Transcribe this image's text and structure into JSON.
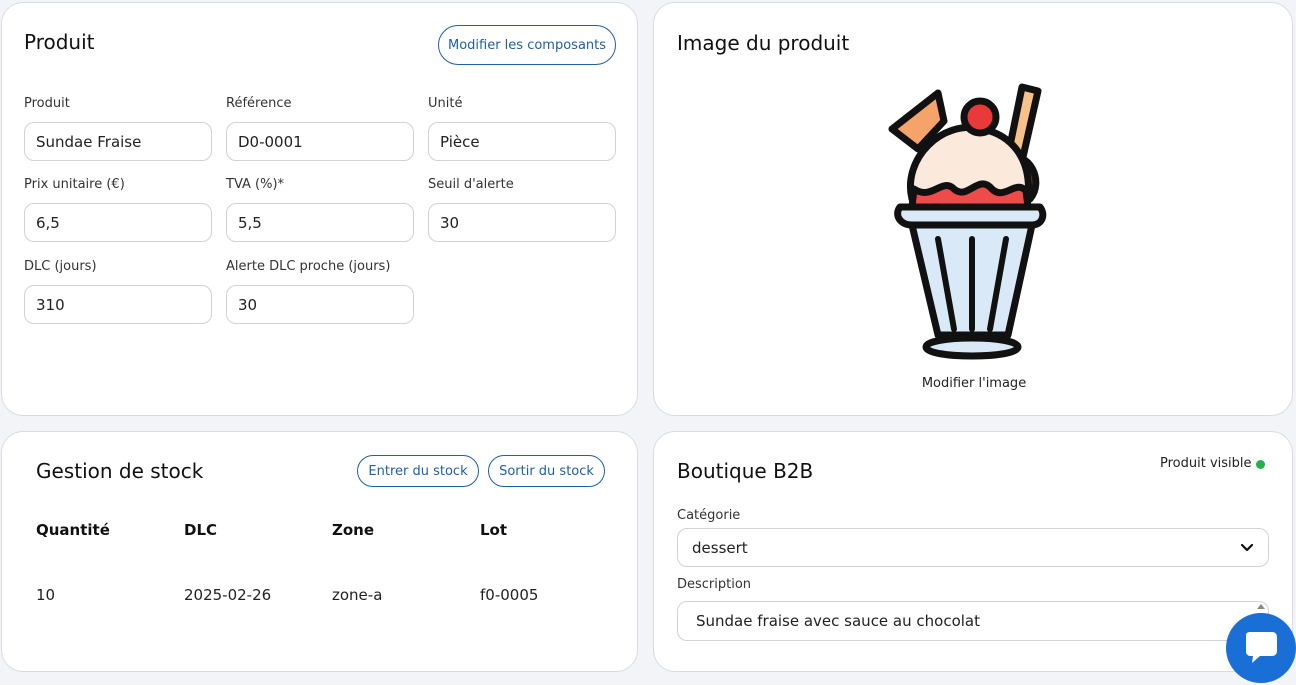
{
  "produit_card": {
    "title": "Produit",
    "modify_components_label": "Modifier les composants",
    "fields": {
      "produit": {
        "label": "Produit",
        "value": "Sundae Fraise"
      },
      "reference": {
        "label": "Référence",
        "value": "D0-0001"
      },
      "unite": {
        "label": "Unité",
        "value": "Pièce"
      },
      "prix_unitaire": {
        "label": "Prix unitaire (€)",
        "value": "6,5"
      },
      "tva": {
        "label": "TVA (%)*",
        "value": "5,5"
      },
      "seuil_alerte": {
        "label": "Seuil d'alerte",
        "value": "30"
      },
      "dlc_jours": {
        "label": "DLC (jours)",
        "value": "310"
      },
      "alerte_dlc": {
        "label": "Alerte DLC proche (jours)",
        "value": "30"
      }
    }
  },
  "image_card": {
    "title": "Image du produit",
    "image_icon": "sundae-icon",
    "modify_image_label": "Modifier l'image"
  },
  "stock_card": {
    "title": "Gestion de stock",
    "enter_stock_label": "Entrer du stock",
    "exit_stock_label": "Sortir du stock",
    "columns": [
      "Quantité",
      "DLC",
      "Zone",
      "Lot"
    ],
    "rows": [
      [
        "10",
        "2025-02-26",
        "zone-a",
        "f0-0005"
      ]
    ]
  },
  "boutique_card": {
    "title": "Boutique B2B",
    "visibility_label": "Produit visible",
    "visibility_color": "#22b14c",
    "category_label": "Catégorie",
    "category_value": "dessert",
    "description_label": "Description",
    "description_value": "Sundae fraise avec sauce au chocolat"
  },
  "chat": {
    "icon": "chat-icon",
    "color": "#1a6fd6"
  }
}
